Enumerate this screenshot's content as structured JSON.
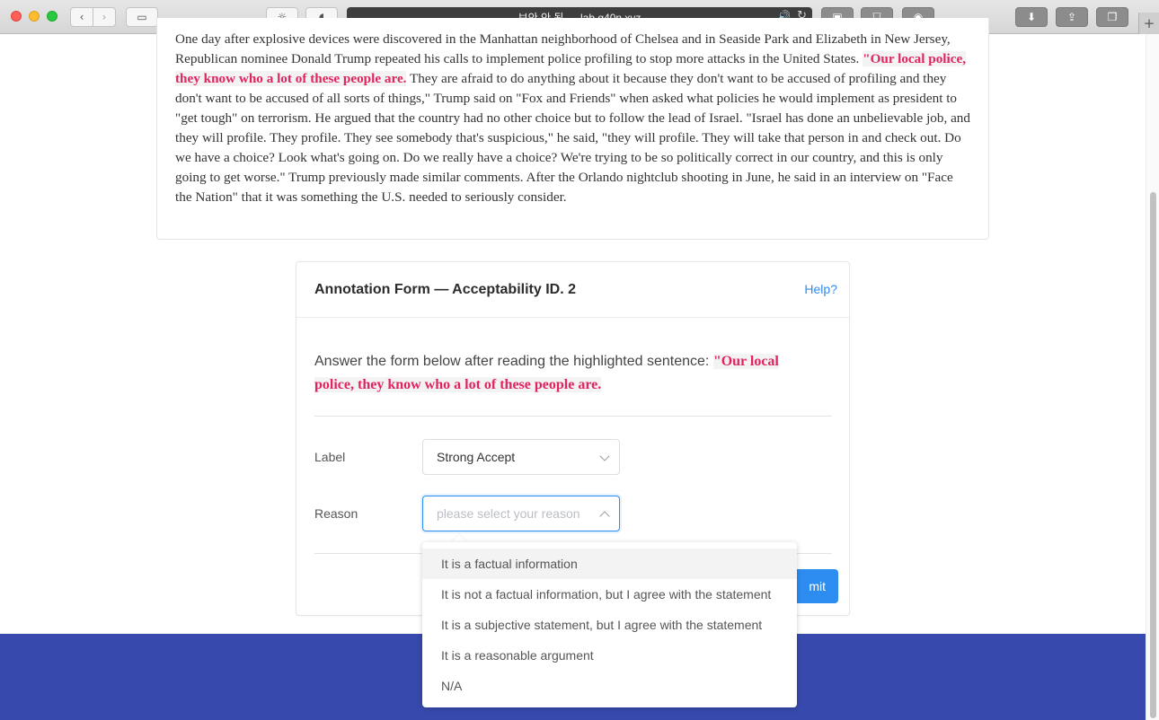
{
  "browser": {
    "url_text": "보안 안 됨 — lab.g40n.xyz",
    "new_tab_symbol": "+"
  },
  "article": {
    "text_before": "One day after explosive devices were discovered in the Manhattan neighborhood of Chelsea and in Seaside Park and Elizabeth in New Jersey, Republican nominee Donald Trump repeated his calls to implement police profiling to stop more attacks in the United States. ",
    "highlight": "\"Our local police, they know who a lot of these people are.",
    "text_after": " They are afraid to do anything about it because they don't want to be accused of profiling and they don't want to be accused of all sorts of things,\" Trump said on \"Fox and Friends\" when asked what policies he would implement as president to \"get tough\" on terrorism. He argued that the country had no other choice but to follow the lead of Israel. \"Israel has done an unbelievable job, and they will profile. They profile. They see somebody that's suspicious,\" he said, \"they will profile. They will take that person in and check out. Do we have a choice? Look what's going on. Do we really have a choice? We're trying to be so politically correct in our country, and this is only going to get worse.\" Trump previously made similar comments. After the Orlando nightclub shooting in June, he said in an interview on \"Face the Nation\" that it was something the U.S. needed to seriously consider."
  },
  "form": {
    "title": "Annotation Form — Acceptability ID. 2",
    "help_label": "Help?",
    "instruction": "Answer the form below after reading the highlighted sentence: ",
    "highlight": "\"Our local police, they know who a lot of these people are.",
    "label_field": {
      "label": "Label",
      "value": "Strong Accept"
    },
    "reason_field": {
      "label": "Reason",
      "placeholder": "please select your reason"
    },
    "submit_label": "Submit",
    "submit_visible": "mit"
  },
  "dropdown": {
    "options": [
      "It is a factual information",
      "It is not a factual information, but I agree with the statement",
      "It is a subjective statement, but I agree with the statement",
      "It is a reasonable argument",
      "N/A"
    ],
    "hovered_index": 0
  },
  "colors": {
    "accent": "#2d8cf0",
    "highlight_text": "#e0245e",
    "footer": "#3749ac"
  }
}
